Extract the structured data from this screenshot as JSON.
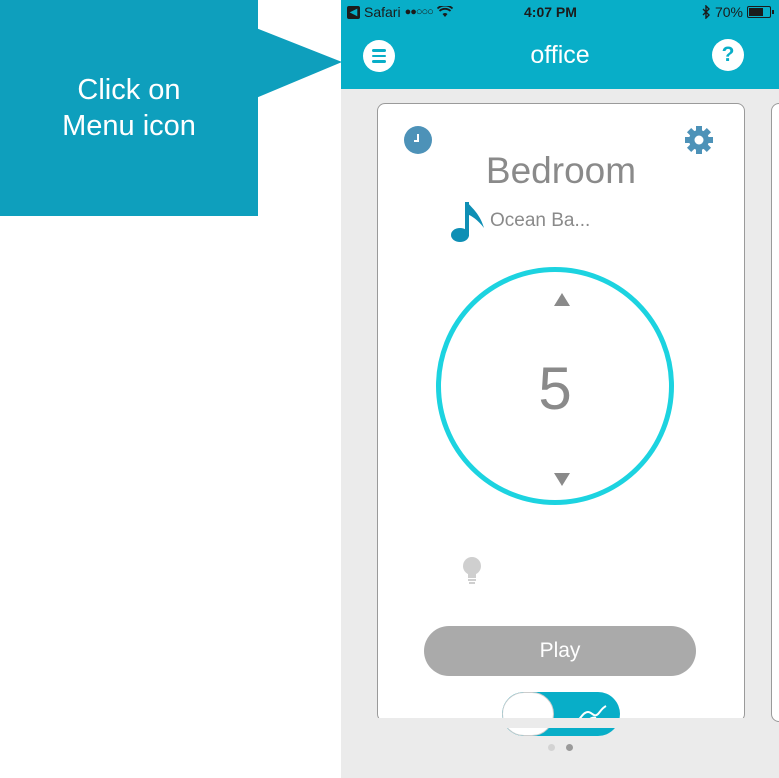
{
  "callout": {
    "line1": "Click on",
    "line2": "Menu icon"
  },
  "status_bar": {
    "back_app": "Safari",
    "signal": "●●○○○",
    "wifi_icon": "wifi-icon",
    "time": "4:07 PM",
    "bluetooth_icon": "bluetooth-icon",
    "battery": "70%"
  },
  "header": {
    "title": "office",
    "help_label": "?"
  },
  "card": {
    "room_name": "Bedroom",
    "sound_name": "Ocean Ba...",
    "level": "5",
    "play_label": "Play"
  },
  "page_indicator": {
    "count": 2,
    "active_index": 1
  },
  "colors": {
    "brand_teal": "#08aec8",
    "ring": "#1cd3e0",
    "callout": "#0e9fbd",
    "text_gray": "#8a8a8a"
  }
}
